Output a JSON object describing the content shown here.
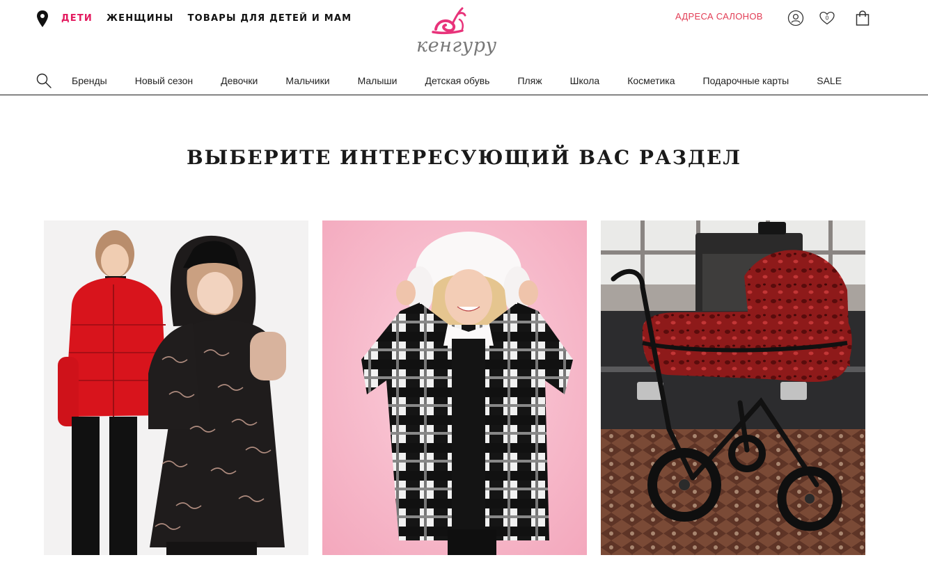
{
  "header": {
    "location_icon": "map-pin-icon",
    "sections": [
      {
        "label": "ДЕТИ",
        "active": true
      },
      {
        "label": "ЖЕНЩИНЫ",
        "active": false
      },
      {
        "label": "ТОВАРЫ ДЛЯ ДЕТЕЙ И МАМ",
        "active": false
      }
    ],
    "logo_text": "кенгуру",
    "salons_link": "АДРЕСА САЛОНОВ",
    "icons": [
      "user-icon",
      "heart-icon",
      "bag-icon"
    ],
    "favorites_count": "0"
  },
  "nav": {
    "search_icon": "search-icon",
    "items": [
      "Бренды",
      "Новый сезон",
      "Девочки",
      "Мальчики",
      "Малыши",
      "Детская обувь",
      "Пляж",
      "Школа",
      "Косметика",
      "Подарочные карты",
      "SALE"
    ]
  },
  "main": {
    "heading": "ВЫБЕРИТЕ ИНТЕРЕСУЮЩИЙ ВАС РАЗДЕЛ"
  },
  "colors": {
    "accent": "#e3185d",
    "salons": "#e23c54",
    "logo_pink": "#e8337a"
  }
}
